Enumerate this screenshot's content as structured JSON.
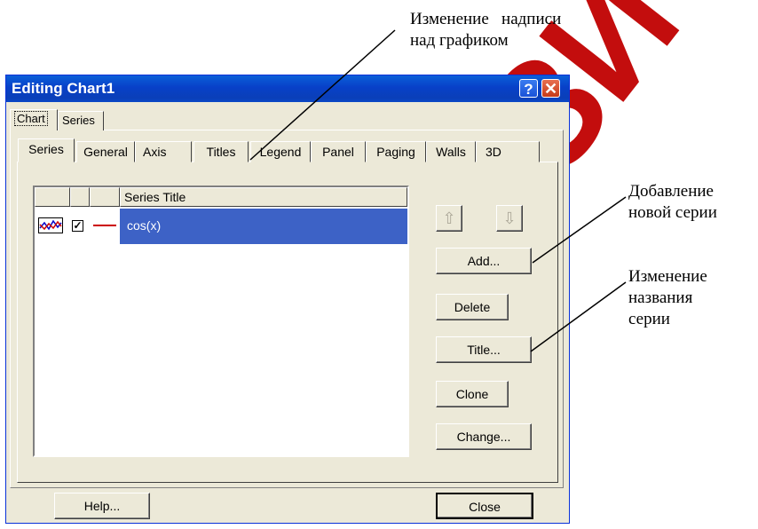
{
  "watermark": {
    "text": "РЕПОЗИТ",
    "color": "#c00000"
  },
  "window": {
    "title": "Editing Chart1",
    "help_symbol": "?",
    "close_symbol": "✕"
  },
  "outer_tabs": [
    "Chart",
    "Series"
  ],
  "inner_tabs": [
    "Series",
    "General",
    "Axis",
    "Titles",
    "Legend",
    "Panel",
    "Paging",
    "Walls",
    "3D"
  ],
  "series_list": {
    "header": "Series Title",
    "rows": [
      {
        "checked": true,
        "line_color": "#cc0000",
        "title": "cos(x)"
      }
    ]
  },
  "side_buttons": {
    "move_up": "⇧",
    "move_down": "⇩",
    "add": "Add...",
    "delete": "Delete",
    "title": "Title...",
    "clone": "Clone",
    "change": "Change..."
  },
  "bottom_buttons": {
    "help": "Help...",
    "close": "Close"
  },
  "annotations": {
    "titles_line1": "Изменение   надписи",
    "titles_line2": "над графиком",
    "add_line1": "Добавление",
    "add_line2": "новой серии",
    "title_line1": "Изменение",
    "title_line2": "названия",
    "title_line3": "серии"
  }
}
